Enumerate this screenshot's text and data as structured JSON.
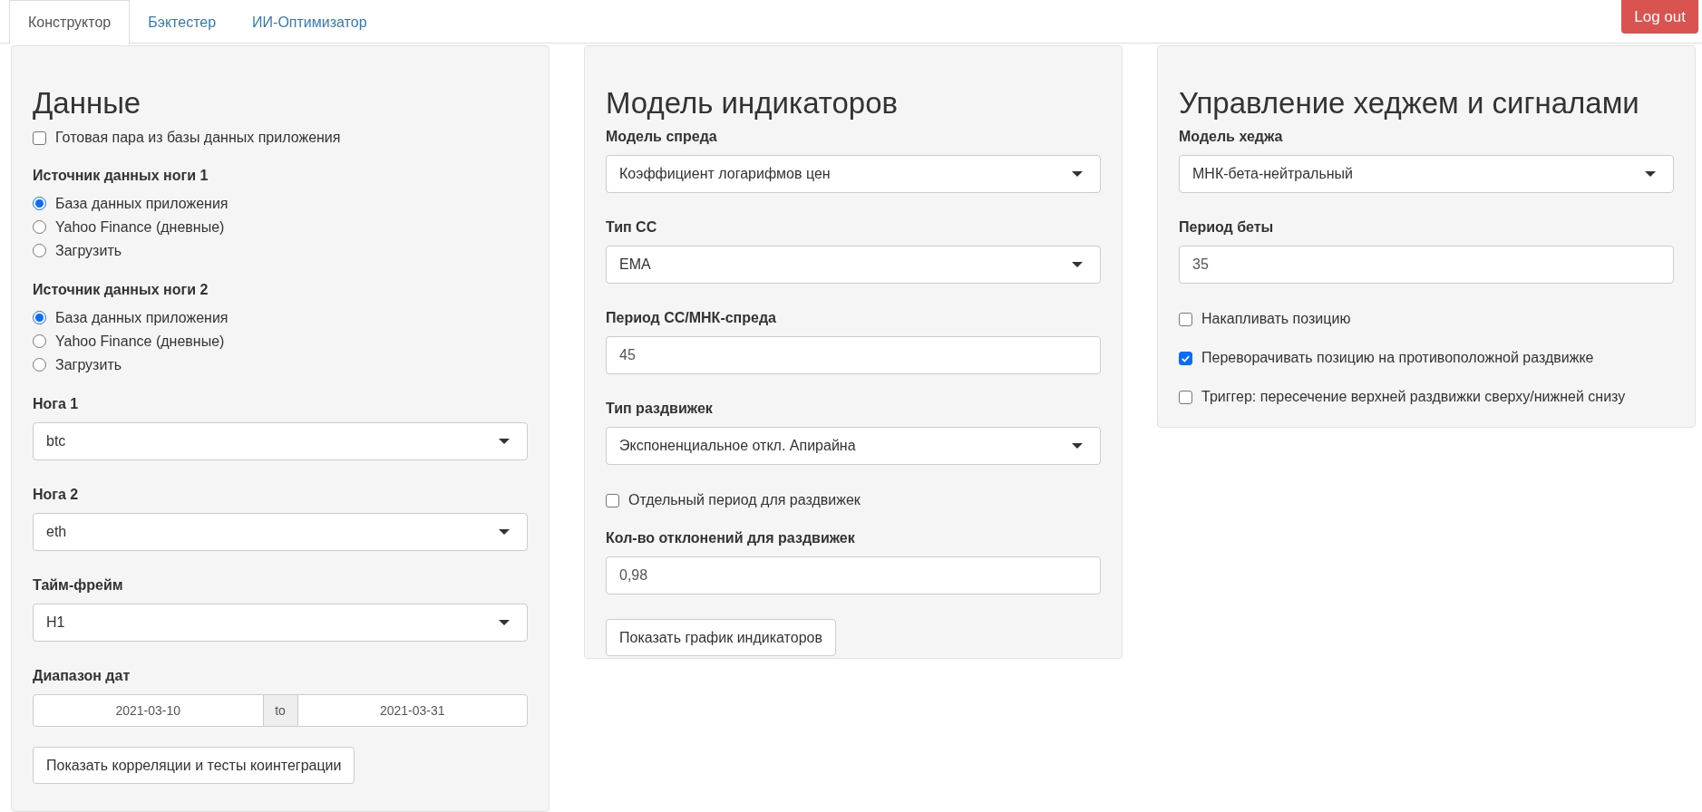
{
  "tabs": [
    {
      "label": "Конструктор",
      "selected": true
    },
    {
      "label": "Бэктестер",
      "selected": false
    },
    {
      "label": "ИИ-Оптимизатор",
      "selected": false
    }
  ],
  "logout_button": "Log out",
  "panels": [
    {
      "title": "Данные",
      "items": [
        {
          "kind": "checkbox",
          "label": "Готовая пара из базы данных приложения",
          "checked": false
        },
        {
          "kind": "radio",
          "label": "Источник данных ноги 1",
          "options": [
            {
              "label": "База данных приложения",
              "selected": true
            },
            {
              "label": "Yahoo Finance (дневные)",
              "selected": false
            },
            {
              "label": "Загрузить",
              "selected": false
            }
          ]
        },
        {
          "kind": "radio",
          "label": "Источник данных ноги 2",
          "options": [
            {
              "label": "База данных приложения",
              "selected": true
            },
            {
              "label": "Yahoo Finance (дневные)",
              "selected": false
            },
            {
              "label": "Загрузить",
              "selected": false
            }
          ]
        },
        {
          "kind": "select",
          "label": "Нога 1",
          "value": "btc"
        },
        {
          "kind": "select",
          "label": "Нога 2",
          "value": "eth"
        },
        {
          "kind": "select",
          "label": "Тайм-фрейм",
          "value": "H1"
        },
        {
          "kind": "daterange",
          "label": "Диапазон дат",
          "start": "2021-03-10",
          "separator": "to",
          "end": "2021-03-31"
        },
        {
          "kind": "button",
          "label": "Показать корреляции и тесты коинтеграции"
        }
      ]
    },
    {
      "title": "Модель индикаторов",
      "items": [
        {
          "kind": "select",
          "label": "Модель спреда",
          "value": "Коэффициент логарифмов цен"
        },
        {
          "kind": "select",
          "label": "Тип СС",
          "value": "EMA"
        },
        {
          "kind": "input",
          "label": "Период СС/МНК-спреда",
          "value": "45"
        },
        {
          "kind": "select",
          "label": "Тип раздвижек",
          "value": "Экспоненциальное откл. Апирайна"
        },
        {
          "kind": "checkbox",
          "label": "Отдельный период для раздвижек",
          "checked": false
        },
        {
          "kind": "input",
          "label": "Кол-во отклонений для раздвижек",
          "value": "0,98"
        },
        {
          "kind": "button",
          "label": "Показать график индикаторов"
        }
      ]
    },
    {
      "title": "Управление хеджем и сигналами",
      "items": [
        {
          "kind": "select",
          "label": "Модель хеджа",
          "value": "МНК-бета-нейтральный"
        },
        {
          "kind": "input",
          "label": "Период беты",
          "value": "35"
        },
        {
          "kind": "checkbox",
          "label": "Накапливать позицию",
          "checked": false
        },
        {
          "kind": "checkbox",
          "label": "Переворачивать позицию на противоположной раздвижке",
          "checked": true
        },
        {
          "kind": "checkbox",
          "label": "Триггер: пересечение верхней раздвижки сверху/нижней снизу",
          "checked": false
        }
      ]
    }
  ]
}
